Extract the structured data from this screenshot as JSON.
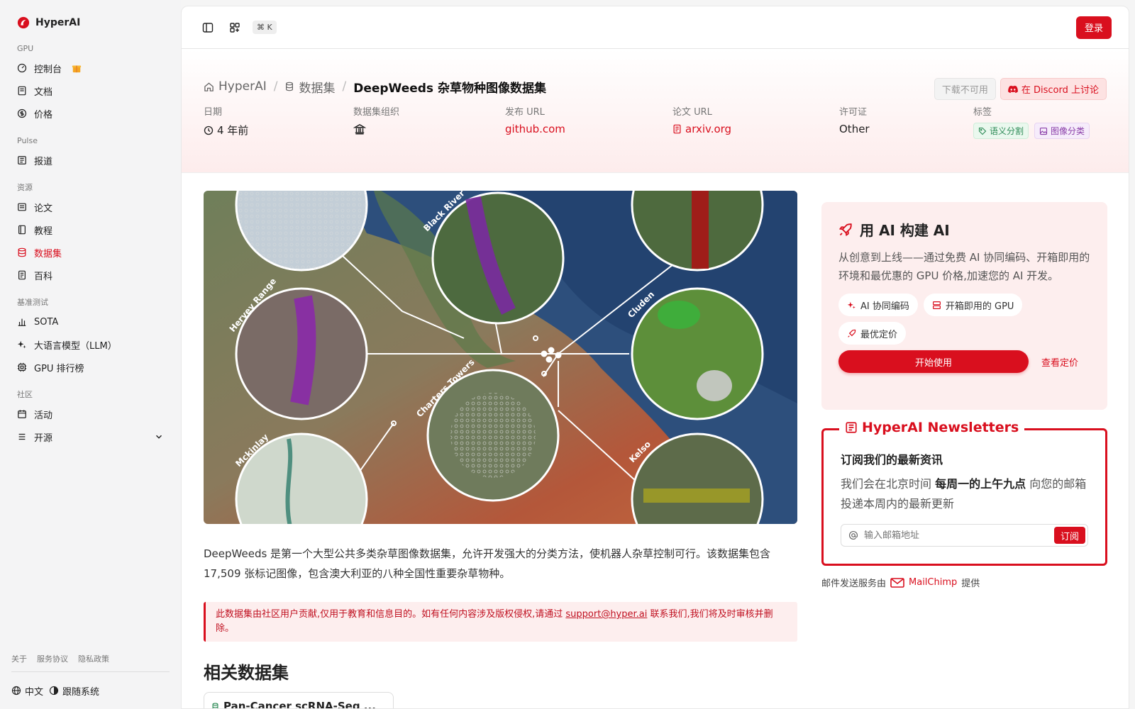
{
  "brand": {
    "name": "HyperAI"
  },
  "sidebar": {
    "sections": [
      {
        "label": "GPU",
        "items": [
          {
            "label": "控制台",
            "icon": "dashboard-icon"
          },
          {
            "label": "文档",
            "icon": "doc-icon"
          },
          {
            "label": "价格",
            "icon": "dollar-icon"
          }
        ]
      },
      {
        "label": "Pulse",
        "items": [
          {
            "label": "报道",
            "icon": "news-icon"
          }
        ]
      },
      {
        "label": "资源",
        "items": [
          {
            "label": "论文",
            "icon": "paper-icon"
          },
          {
            "label": "教程",
            "icon": "book-icon"
          },
          {
            "label": "数据集",
            "icon": "database-icon",
            "active": true
          },
          {
            "label": "百科",
            "icon": "wiki-icon"
          }
        ]
      },
      {
        "label": "基准测试",
        "items": [
          {
            "label": "SOTA",
            "icon": "bar-chart-icon"
          },
          {
            "label": "大语言模型（LLM）",
            "icon": "sparkle-icon"
          },
          {
            "label": "GPU 排行榜",
            "icon": "chip-icon"
          }
        ]
      },
      {
        "label": "社区",
        "items": [
          {
            "label": "活动",
            "icon": "calendar-icon"
          },
          {
            "label": "开源",
            "icon": "list-icon"
          }
        ]
      }
    ],
    "footer_links": [
      "关于",
      "服务协议",
      "隐私政策"
    ],
    "language": "中文",
    "theme": "跟随系统"
  },
  "topbar": {
    "shortcut": "⌘ K",
    "login": "登录"
  },
  "hero": {
    "breadcrumb": [
      "HyperAI",
      "数据集",
      "DeepWeeds 杂草物种图像数据集"
    ],
    "download_btn": "下载不可用",
    "discord_btn": "在 Discord 上讨论",
    "meta": {
      "date_label": "日期",
      "date_value": "4 年前",
      "org_label": "数据集组织",
      "publish_label": "发布 URL",
      "publish_value": "github.com",
      "paper_label": "论文 URL",
      "paper_value": "arxiv.org",
      "license_label": "许可证",
      "license_value": "Other",
      "tags_label": "标签",
      "tags": [
        "语义分割",
        "图像分类"
      ]
    }
  },
  "figure": {
    "labels": [
      "Black River",
      "Hervey Range",
      "Cluden",
      "Charters Towers",
      "Mckinlay",
      "Kelso"
    ]
  },
  "content": {
    "description": "DeepWeeds 是第一个大型公共多类杂草图像数据集，允许开发强大的分类方法，使机器人杂草控制可行。该数据集包含 17,509 张标记图像，包含澳大利亚的八种全国性重要杂草物种。",
    "notice_before": "此数据集由社区用户贡献,仅用于教育和信息目的。如有任何内容涉及版权侵权,请通过 ",
    "notice_email": "support@hyper.ai",
    "notice_after": " 联系我们,我们将及时审核并删除。",
    "related_title": "相关数据集",
    "related": [
      "Pan-Cancer scRNA-Seq ..."
    ]
  },
  "ai_card": {
    "title": "用 AI 构建 AI",
    "description": "从创意到上线——通过免费 AI 协同编码、开箱即用的环境和最优惠的 GPU 价格,加速您的 AI 开发。",
    "chips": [
      "AI 协同编码",
      "开箱即用的 GPU",
      "最优定价"
    ],
    "start": "开始使用",
    "pricing": "查看定价"
  },
  "newsletter": {
    "title": "HyperAI Newsletters",
    "subtitle": "订阅我们的最新资讯",
    "desc_before": "我们会在北京时间 ",
    "desc_bold": "每周一的上午九点",
    "desc_after": " 向您的邮箱投递本周内的最新更新",
    "placeholder": "输入邮箱地址",
    "subscribe": "订阅",
    "powered_before": "邮件发送服务由",
    "powered_brand": "MailChimp",
    "powered_after": "提供"
  },
  "colors": {
    "accent": "#d90f1e",
    "sidebar_bg": "#f4f4f5"
  }
}
